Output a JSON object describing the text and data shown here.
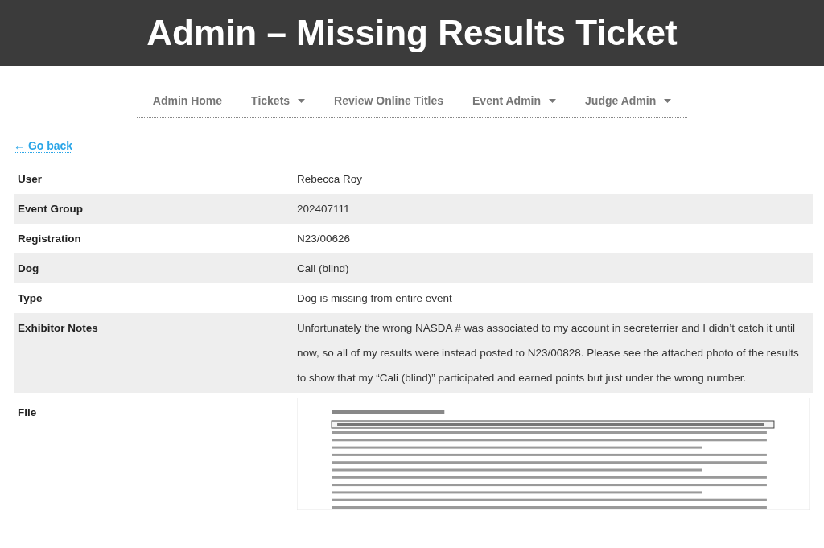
{
  "header": {
    "title": "Admin – Missing Results Ticket"
  },
  "nav": [
    {
      "label": "Admin Home",
      "dropdown": false
    },
    {
      "label": "Tickets",
      "dropdown": true
    },
    {
      "label": "Review Online Titles",
      "dropdown": false
    },
    {
      "label": "Event Admin",
      "dropdown": true
    },
    {
      "label": "Judge Admin",
      "dropdown": true
    }
  ],
  "back_link": "← Go back",
  "details": [
    {
      "label": "User",
      "value": "Rebecca Roy"
    },
    {
      "label": "Event Group",
      "value": "202407111"
    },
    {
      "label": "Registration",
      "value": "N23/00626"
    },
    {
      "label": "Dog",
      "value": "Cali (blind)"
    },
    {
      "label": "Type",
      "value": "Dog is missing from entire event"
    },
    {
      "label": "Exhibitor Notes",
      "value": "Unfortunately the wrong NASDA # was associated to my account in secreterrier and I didn’t catch it until now, so all of my results were instead posted to N23/00828. Please see the attached photo of the results to show that my “Cali (blind)” participated and earned points but just under the wrong number."
    }
  ],
  "file": {
    "label": "File",
    "kind": "picture"
  }
}
